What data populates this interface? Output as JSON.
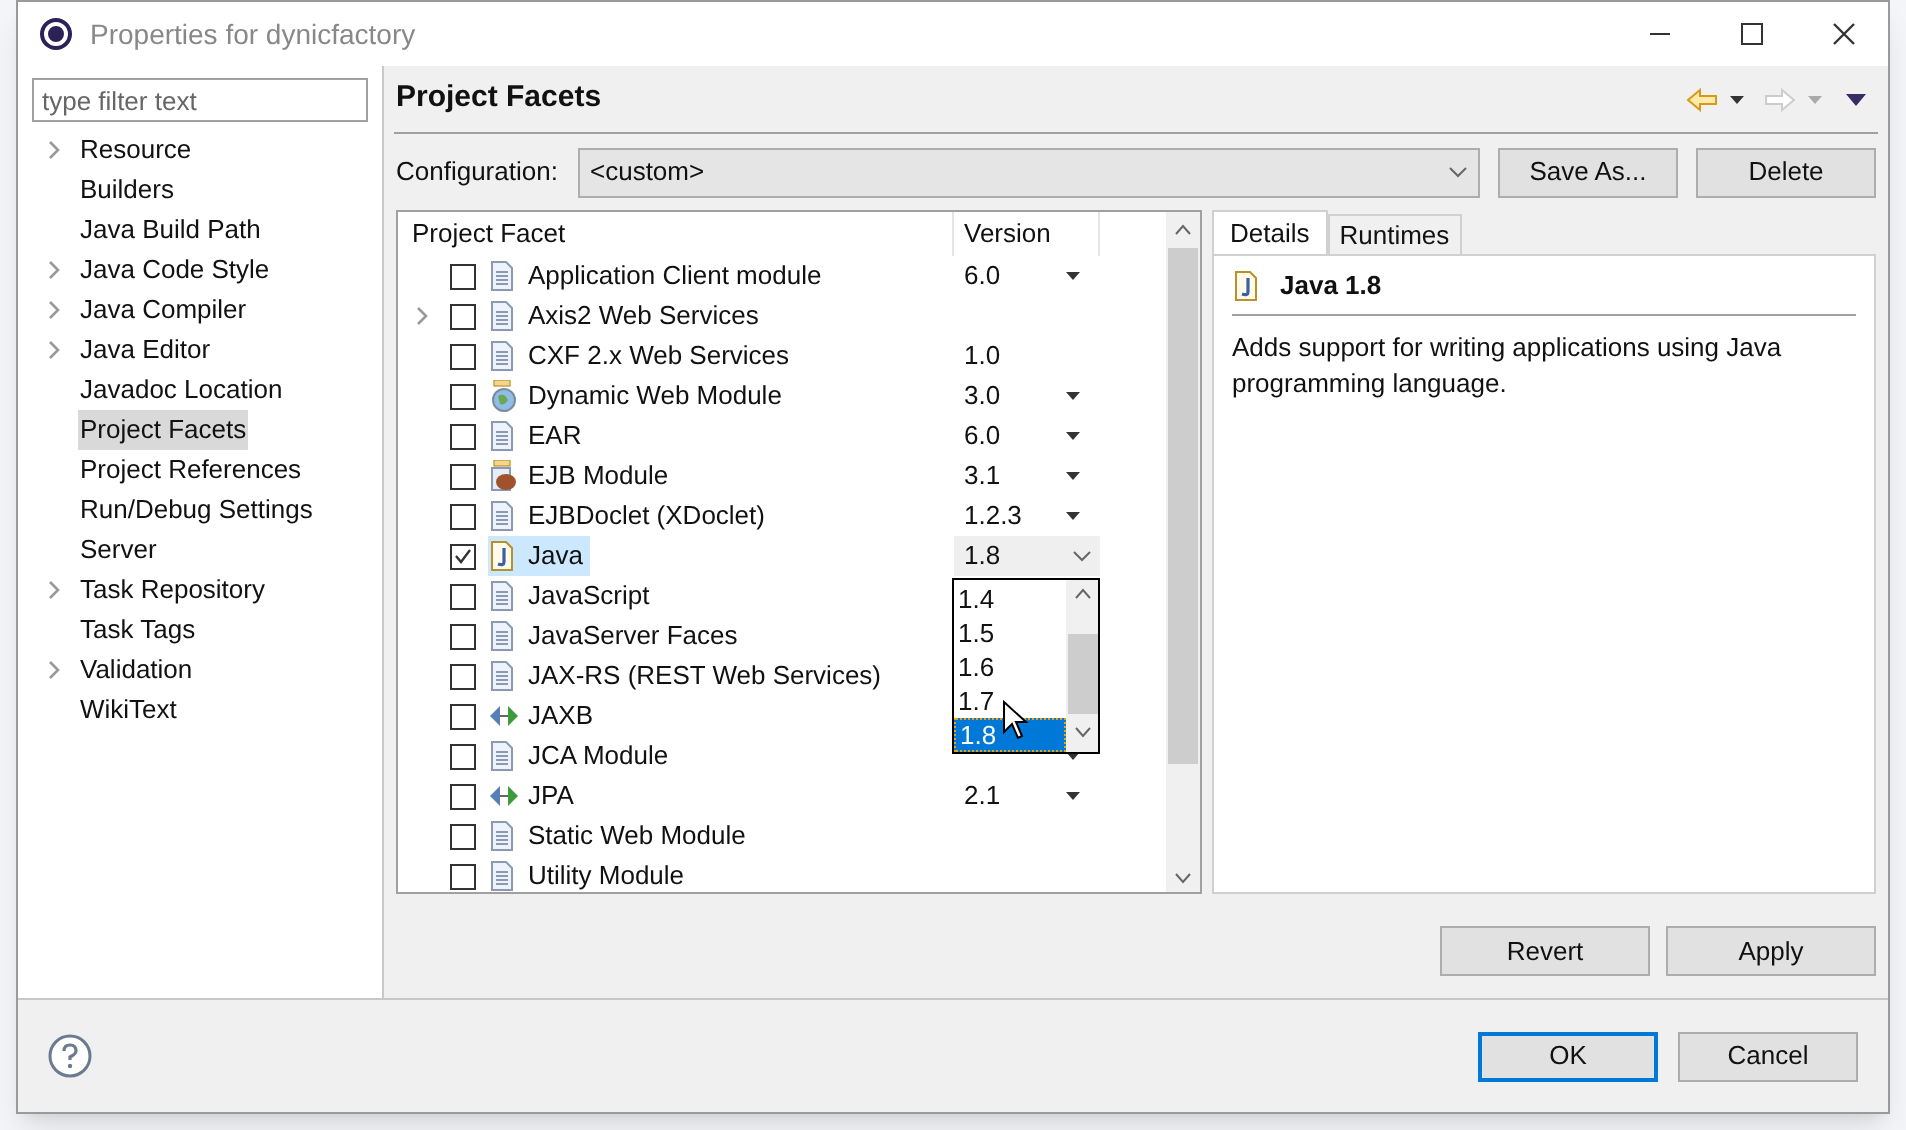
{
  "window": {
    "title": "Properties for dynicfactory"
  },
  "filter": {
    "placeholder": "type filter text"
  },
  "sidebar": {
    "items": [
      {
        "label": "Resource",
        "expandable": true,
        "selected": false
      },
      {
        "label": "Builders",
        "expandable": false,
        "selected": false
      },
      {
        "label": "Java Build Path",
        "expandable": false,
        "selected": false
      },
      {
        "label": "Java Code Style",
        "expandable": true,
        "selected": false
      },
      {
        "label": "Java Compiler",
        "expandable": true,
        "selected": false
      },
      {
        "label": "Java Editor",
        "expandable": true,
        "selected": false
      },
      {
        "label": "Javadoc Location",
        "expandable": false,
        "selected": false
      },
      {
        "label": "Project Facets",
        "expandable": false,
        "selected": true
      },
      {
        "label": "Project References",
        "expandable": false,
        "selected": false
      },
      {
        "label": "Run/Debug Settings",
        "expandable": false,
        "selected": false
      },
      {
        "label": "Server",
        "expandable": false,
        "selected": false
      },
      {
        "label": "Task Repository",
        "expandable": true,
        "selected": false
      },
      {
        "label": "Task Tags",
        "expandable": false,
        "selected": false
      },
      {
        "label": "Validation",
        "expandable": true,
        "selected": false
      },
      {
        "label": "WikiText",
        "expandable": false,
        "selected": false
      }
    ]
  },
  "page": {
    "title": "Project Facets",
    "configuration_label": "Configuration:",
    "configuration_value": "<custom>",
    "buttons": [
      "Save As...",
      "Delete"
    ]
  },
  "table": {
    "columns": [
      "Project Facet",
      "Version"
    ],
    "rows": [
      {
        "name": "Application Client module",
        "kind": "doc",
        "version": "6.0",
        "has_menu": true,
        "expandable": false,
        "checked": false,
        "selected": false
      },
      {
        "name": "Axis2 Web Services",
        "kind": "doc",
        "expandable": true,
        "has_menu": false,
        "checked": false,
        "selected": false
      },
      {
        "name": "CXF 2.x Web Services",
        "kind": "doc",
        "version": "1.0",
        "has_menu": false,
        "expandable": false,
        "checked": false,
        "selected": false
      },
      {
        "name": "Dynamic Web Module",
        "kind": "globe",
        "version": "3.0",
        "has_menu": true,
        "expandable": false,
        "checked": false,
        "selected": false
      },
      {
        "name": "EAR",
        "kind": "doc",
        "version": "6.0",
        "has_menu": true,
        "expandable": false,
        "checked": false,
        "selected": false
      },
      {
        "name": "EJB Module",
        "kind": "bean",
        "version": "3.1",
        "has_menu": true,
        "expandable": false,
        "checked": false,
        "selected": false
      },
      {
        "name": "EJBDoclet (XDoclet)",
        "kind": "doc",
        "version": "1.2.3",
        "has_menu": true,
        "expandable": false,
        "checked": false,
        "selected": false
      },
      {
        "name": "Java",
        "kind": "java",
        "version": "1.8",
        "has_menu": true,
        "expandable": false,
        "checked": true,
        "selected": true
      },
      {
        "name": "JavaScript",
        "kind": "doc",
        "expandable": false,
        "checked": false,
        "selected": false
      },
      {
        "name": "JavaServer Faces",
        "kind": "doc",
        "expandable": false,
        "checked": false,
        "selected": false
      },
      {
        "name": "JAX-RS (REST Web Services)",
        "kind": "doc",
        "expandable": false,
        "checked": false,
        "selected": false
      },
      {
        "name": "JAXB",
        "kind": "arrows",
        "expandable": false,
        "checked": false,
        "selected": false
      },
      {
        "name": "JCA Module",
        "kind": "doc",
        "has_menu": true,
        "expandable": false,
        "checked": false,
        "selected": false
      },
      {
        "name": "JPA",
        "kind": "arrows",
        "version": "2.1",
        "has_menu": true,
        "expandable": false,
        "checked": false,
        "selected": false
      },
      {
        "name": "Static Web Module",
        "kind": "doc",
        "has_menu": false,
        "expandable": false,
        "checked": false,
        "selected": false
      },
      {
        "name": "Utility Module",
        "kind": "doc",
        "has_menu": false,
        "expandable": false,
        "checked": false,
        "selected": false
      }
    ]
  },
  "version_dropdown": {
    "options": [
      {
        "label": "1.4",
        "selected": false
      },
      {
        "label": "1.5",
        "selected": false
      },
      {
        "label": "1.6",
        "selected": false
      },
      {
        "label": "1.7",
        "selected": false
      },
      {
        "label": "1.8",
        "selected": true
      }
    ]
  },
  "details": {
    "tabs": [
      {
        "label": "Details",
        "selected": true
      },
      {
        "label": "Runtimes",
        "selected": false
      }
    ],
    "title": "Java 1.8",
    "description": "Adds support for writing applications using Java programming language."
  },
  "actions": [
    "Revert",
    "Apply"
  ],
  "dialog_buttons": [
    {
      "label": "OK",
      "default": true
    },
    {
      "label": "Cancel",
      "default": false
    }
  ]
}
